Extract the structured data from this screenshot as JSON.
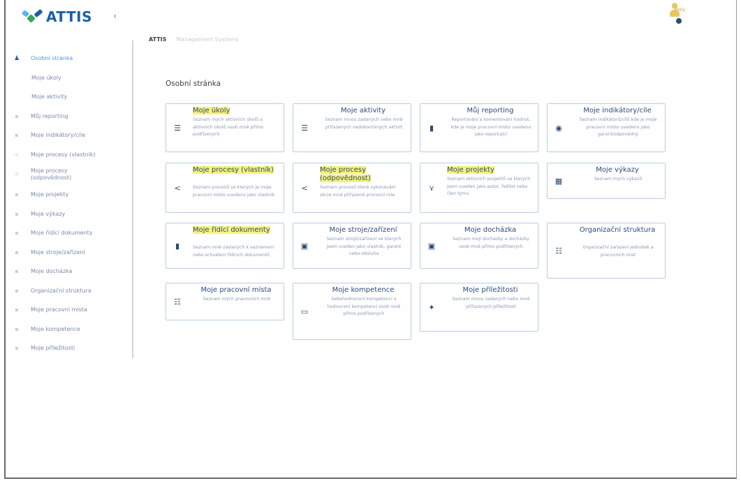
{
  "app": {
    "name": "ATTIS",
    "collapse_icon": "‹"
  },
  "header": {
    "user_label": "Holy",
    "breadcrumb": [
      "ATTIS",
      "Management Systems"
    ]
  },
  "sidebar": {
    "items": [
      {
        "label": "Osobní stránka",
        "icon": "person-icon",
        "glyph": "♟",
        "active": true
      },
      {
        "label": "Moje úkoly",
        "sub": true
      },
      {
        "label": "Moje aktivity",
        "sub": true
      },
      {
        "label": "Můj reporting",
        "icon": "chart-icon",
        "glyph": "▪"
      },
      {
        "label": "Moje indikátory/cíle",
        "icon": "gauge-icon",
        "glyph": "▪"
      },
      {
        "label": "Moje procesy (vlastník)",
        "icon": "share-icon",
        "glyph": "<"
      },
      {
        "label": "Moje procesy (odpovědnost)",
        "icon": "share-icon",
        "glyph": "<"
      },
      {
        "label": "Moje projekty",
        "icon": "project-icon",
        "glyph": "▪"
      },
      {
        "label": "Moje výkazy",
        "icon": "report-icon",
        "glyph": "▪"
      },
      {
        "label": "Moje řídící dokumenty",
        "icon": "document-icon",
        "glyph": "▪"
      },
      {
        "label": "Moje stroje/zařízení",
        "icon": "machine-icon",
        "glyph": "▪"
      },
      {
        "label": "Moje docházka",
        "icon": "attendance-icon",
        "glyph": "▪"
      },
      {
        "label": "Organizační struktura",
        "icon": "org-icon",
        "glyph": "▪"
      },
      {
        "label": "Moje pracovní místa",
        "icon": "org-icon",
        "glyph": "▪"
      },
      {
        "label": "Moje kompetence",
        "icon": "competence-icon",
        "glyph": "▪"
      },
      {
        "label": "Moje příležitosti",
        "icon": "opportunity-icon",
        "glyph": "▪"
      }
    ]
  },
  "main": {
    "title": "Osobní stránka",
    "cards": [
      {
        "title": "Moje úkoly",
        "desc": "Seznam mých aktivních úkolů a aktivních úkolů osob mně přímo podřízených",
        "icon": "list-icon",
        "glyph": "☰",
        "highlight": true
      },
      {
        "title": "Moje aktivity",
        "desc": "Seznam mnou zadaných nebo mně přiřazených nedokončených aktivit",
        "icon": "list-icon",
        "glyph": "☰"
      },
      {
        "title": "Můj reporting",
        "desc": "Reportování a komentování hodnot, kde je moje pracovní místo uvedeno jako reportující",
        "icon": "bar-chart-icon",
        "glyph": "▮"
      },
      {
        "title": "Moje indikátory/cíle",
        "desc": "Seznam indikátorů/cílů kde je moje pracovní místo uvedeno jako garant/odpovědný",
        "icon": "gauge-icon",
        "glyph": "◉"
      },
      {
        "title": "Moje procesy (vlastník)",
        "desc": "Seznam procesů ve kterých je moje pracovní místo uvedeno jako vlastník",
        "icon": "share-icon",
        "glyph": "<",
        "highlight": true
      },
      {
        "title": "Moje procesy (odpovědnost)",
        "desc": "Seznam procesů které vykonávám skrze mně přiřazené procesní role",
        "icon": "share-icon",
        "glyph": "<",
        "highlight": true
      },
      {
        "title": "Moje projekty",
        "desc": "Seznam aktivních projektů ve kterých jsem uveden jako autor, řešitel nebo člen týmu",
        "icon": "project-icon",
        "glyph": "⋎",
        "highlight": true
      },
      {
        "title": "Moje výkazy",
        "desc": "Seznam mých výkazů",
        "icon": "calendar-icon",
        "glyph": "▦"
      },
      {
        "title": "Moje řídící dokumenty",
        "desc": "Seznam mně zaslaných k seznámení nebo schválení řídících dokumentů",
        "icon": "document-icon",
        "glyph": "▮",
        "highlight": true
      },
      {
        "title": "Moje stroje/zařízení",
        "desc": "Seznam strojů/zařízení ve kterých jsem uveden jako vlastník, garant nebo obsluha",
        "icon": "machine-icon",
        "glyph": "▣"
      },
      {
        "title": "Moje docházka",
        "desc": "Seznam mojí docházky a docházky osob mně přímo podřízených",
        "icon": "attendance-icon",
        "glyph": "▣"
      },
      {
        "title": "Organizační struktura",
        "desc": "Organizační zařazení jednotek a pracovních míst",
        "icon": "org-icon",
        "glyph": "☷"
      },
      {
        "title": "Moje pracovní místa",
        "desc": "Seznam mých pracovních míst",
        "icon": "org-icon",
        "glyph": "☷"
      },
      {
        "title": "Moje kompetence",
        "desc": "Sebehodnocení kompetencí a hodnocení kompetencí osob mně přímo podřízených",
        "icon": "competence-icon",
        "glyph": "▭"
      },
      {
        "title": "Moje příležitosti",
        "desc": "Seznam mnou zadaných nebo mně přiřazených příležitostí",
        "icon": "opportunity-icon",
        "glyph": "✦"
      }
    ]
  },
  "colors": {
    "brand": "#1e5fa8",
    "accent": "#5d8fe0",
    "card_border": "#b9cde8",
    "highlight": "#f7f27a"
  }
}
